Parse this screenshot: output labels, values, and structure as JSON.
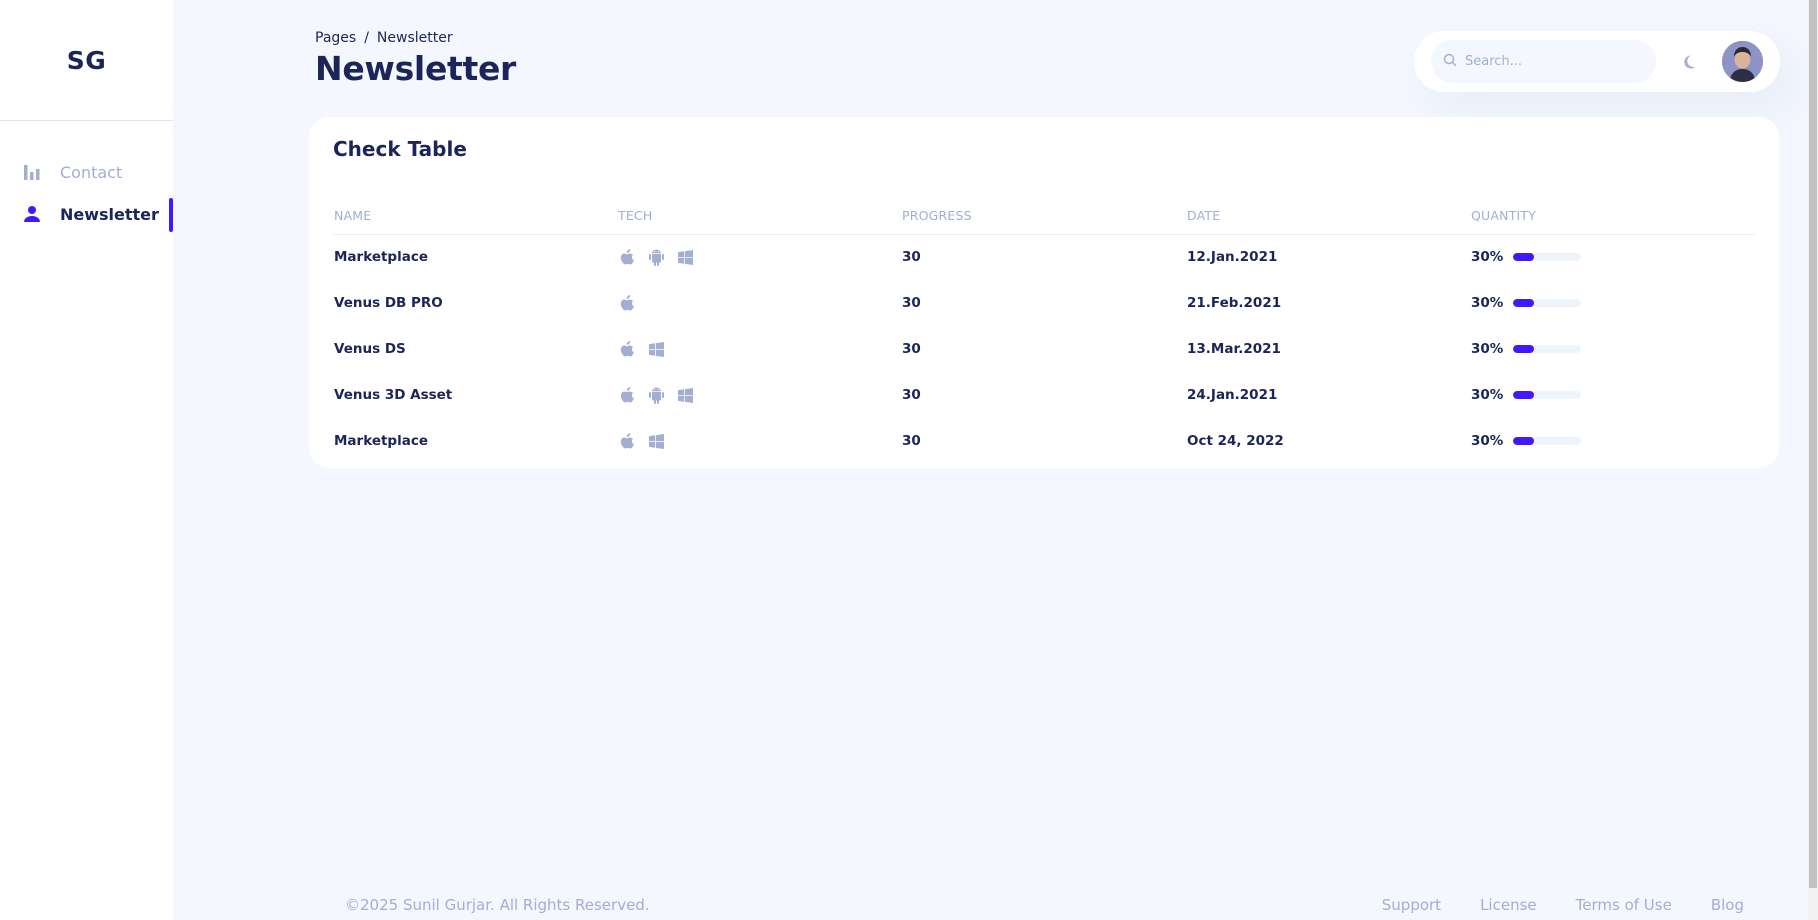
{
  "brand": {
    "logo_text": "SG"
  },
  "sidebar": {
    "items": [
      {
        "label": "Contact",
        "icon": "bar-chart-icon",
        "active": false
      },
      {
        "label": "Newsletter",
        "icon": "person-icon",
        "active": true
      }
    ]
  },
  "header": {
    "breadcrumb": {
      "root": "Pages",
      "separator": "/",
      "current": "Newsletter"
    },
    "title": "Newsletter"
  },
  "topbar": {
    "search_placeholder": "Search..."
  },
  "table": {
    "title": "Check Table",
    "columns": [
      "NAME",
      "TECH",
      "PROGRESS",
      "DATE",
      "QUANTITY"
    ],
    "rows": [
      {
        "name": "Marketplace",
        "tech": [
          "apple",
          "android",
          "windows"
        ],
        "progress": "30",
        "date": "12.Jan.2021",
        "quantity": "30%",
        "quantity_value": 0.3
      },
      {
        "name": "Venus DB PRO",
        "tech": [
          "apple"
        ],
        "progress": "30",
        "date": "21.Feb.2021",
        "quantity": "30%",
        "quantity_value": 0.3
      },
      {
        "name": "Venus DS",
        "tech": [
          "apple",
          "windows"
        ],
        "progress": "30",
        "date": "13.Mar.2021",
        "quantity": "30%",
        "quantity_value": 0.3
      },
      {
        "name": "Venus 3D Asset",
        "tech": [
          "apple",
          "android",
          "windows"
        ],
        "progress": "30",
        "date": "24.Jan.2021",
        "quantity": "30%",
        "quantity_value": 0.3
      },
      {
        "name": "Marketplace",
        "tech": [
          "apple",
          "windows"
        ],
        "progress": "30",
        "date": "Oct 24, 2022",
        "quantity": "30%",
        "quantity_value": 0.3
      }
    ]
  },
  "footer": {
    "copyright": "©2025 Sunil Gurjar. All Rights Reserved.",
    "links": [
      "Support",
      "License",
      "Terms of Use",
      "Blog"
    ]
  },
  "colors": {
    "accent": "#4318ff",
    "text_primary": "#1b2559",
    "text_muted": "#a3aed0",
    "background": "#f4f7fe"
  }
}
